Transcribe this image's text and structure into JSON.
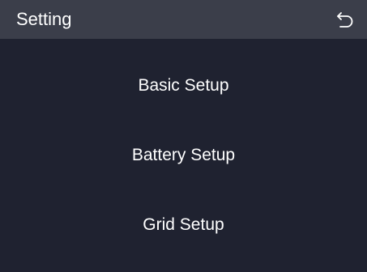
{
  "header": {
    "title": "Setting",
    "back_icon": "back-arrow-icon"
  },
  "menu": {
    "items": [
      {
        "label": "Basic Setup"
      },
      {
        "label": "Battery Setup"
      },
      {
        "label": "Grid Setup"
      }
    ]
  },
  "colors": {
    "background": "#1f2230",
    "header_background": "#3b3e4a",
    "text": "#ffffff"
  }
}
